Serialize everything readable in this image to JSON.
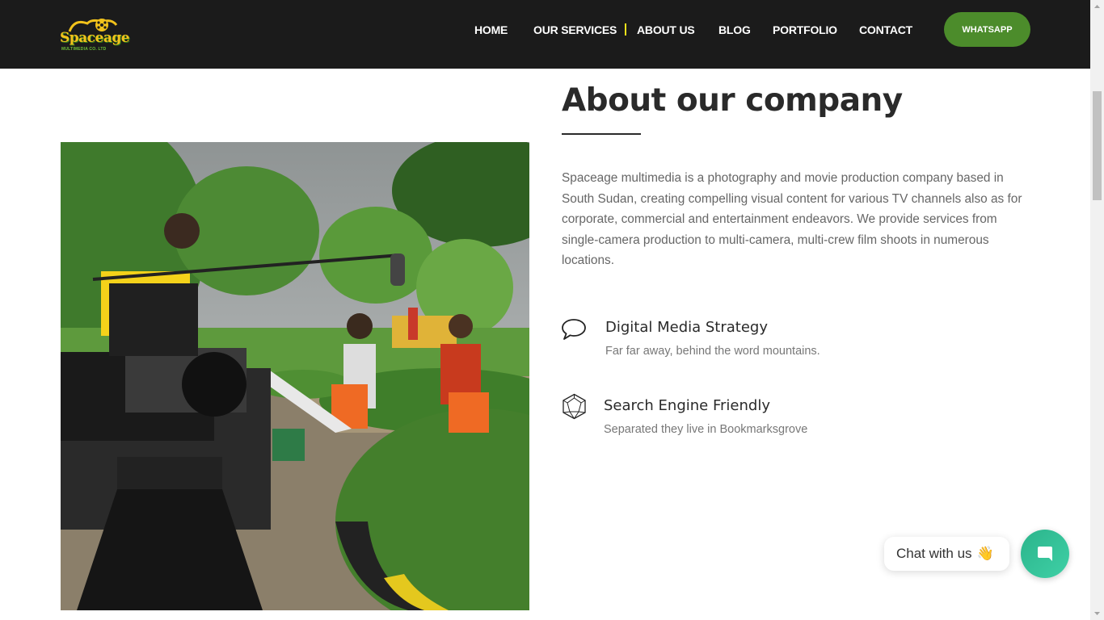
{
  "brand": {
    "name": "Spaceage",
    "subtitle": "MULTIMEDIA CO. LTD"
  },
  "nav": {
    "items": [
      {
        "label": "HOME"
      },
      {
        "label": "OUR SERVICES"
      },
      {
        "label": "ABOUT US"
      },
      {
        "label": "BLOG"
      },
      {
        "label": "PORTFOLIO"
      },
      {
        "label": "CONTACT"
      }
    ],
    "whatsapp_label": "WHATSAPP",
    "active_color": "#f2e21b"
  },
  "about": {
    "heading": "About our company",
    "paragraph": "Spaceage multimedia is a photography and movie production company based in South Sudan, creating compelling visual content for various TV channels also as for corporate, commercial and entertainment endeavors. We provide services from single-camera production to multi-camera, multi-crew film shoots in numerous locations.",
    "features": [
      {
        "icon": "speech-bubble-icon",
        "title": "Digital Media Strategy",
        "description": "Far far away, behind the word mountains."
      },
      {
        "icon": "polyhedron-icon",
        "title": "Search Engine Friendly",
        "description": "Separated they live in Bookmarksgrove"
      }
    ]
  },
  "chat": {
    "label": "Chat with us",
    "emoji": "👋"
  },
  "colors": {
    "navbar": "#1b1b1b",
    "whatsapp": "#4c8c2b",
    "chat_button": "#2bb48b"
  }
}
